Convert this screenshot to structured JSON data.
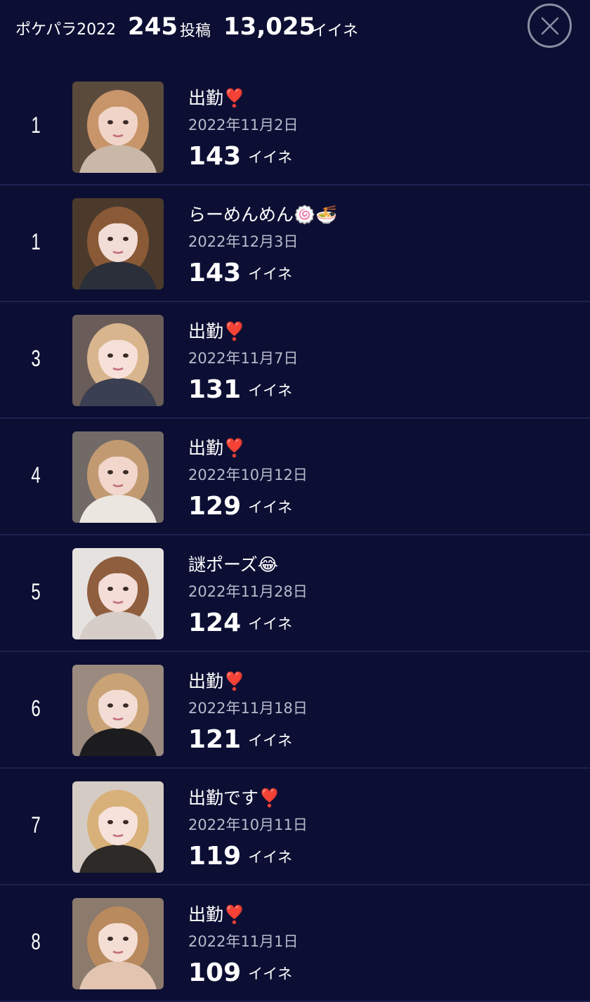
{
  "header": {
    "title": "ポケパラ2022",
    "posts_count": "245",
    "posts_label": "投稿",
    "likes_total": "13,025",
    "likes_label": "イイネ",
    "close_icon": "close-icon"
  },
  "likes_unit": "イイネ",
  "posts": [
    {
      "rank": "1",
      "title": "出勤❣️",
      "date": "2022年11月2日",
      "likes": "143",
      "photo": {
        "bg": "#5a4a3c",
        "hair": "#c8956a",
        "skin": "#f0d4c8",
        "cloth": "#c9b8a8"
      }
    },
    {
      "rank": "1",
      "title": "らーめんめん🍥🍜",
      "date": "2022年12月3日",
      "likes": "143",
      "photo": {
        "bg": "#4b3a2c",
        "hair": "#8a5a36",
        "skin": "#f2dcd6",
        "cloth": "#2a2f3a"
      }
    },
    {
      "rank": "3",
      "title": "出勤❣️",
      "date": "2022年11月7日",
      "likes": "131",
      "photo": {
        "bg": "#6a5c58",
        "hair": "#d9b58e",
        "skin": "#f6e0d8",
        "cloth": "#3a3f52"
      }
    },
    {
      "rank": "4",
      "title": "出勤❣️",
      "date": "2022年10月12日",
      "likes": "129",
      "photo": {
        "bg": "#726a66",
        "hair": "#c29a72",
        "skin": "#f2d6cc",
        "cloth": "#ece6e0"
      }
    },
    {
      "rank": "5",
      "title": "謎ポーズ😂",
      "date": "2022年11月28日",
      "likes": "124",
      "photo": {
        "bg": "#e6e2e0",
        "hair": "#8f5e3e",
        "skin": "#f4ddd6",
        "cloth": "#d6cdc8"
      }
    },
    {
      "rank": "6",
      "title": "出勤❣️",
      "date": "2022年11月18日",
      "likes": "121",
      "photo": {
        "bg": "#9a8a80",
        "hair": "#c9a276",
        "skin": "#f2dcd4",
        "cloth": "#1c1c1e"
      }
    },
    {
      "rank": "7",
      "title": "出勤です❣️",
      "date": "2022年10月11日",
      "likes": "119",
      "photo": {
        "bg": "#d4ccc4",
        "hair": "#d8b07a",
        "skin": "#f6e2da",
        "cloth": "#2e2a28"
      }
    },
    {
      "rank": "8",
      "title": "出勤❣️",
      "date": "2022年11月1日",
      "likes": "109",
      "photo": {
        "bg": "#8c7a6c",
        "hair": "#b98a5e",
        "skin": "#f4ddd2",
        "cloth": "#e2c4b0"
      }
    }
  ],
  "colors": {
    "background": "#0c0f33",
    "divider": "#1c2150",
    "date_text": "#b8bbcc",
    "close_ring": "#8a8ea3"
  }
}
